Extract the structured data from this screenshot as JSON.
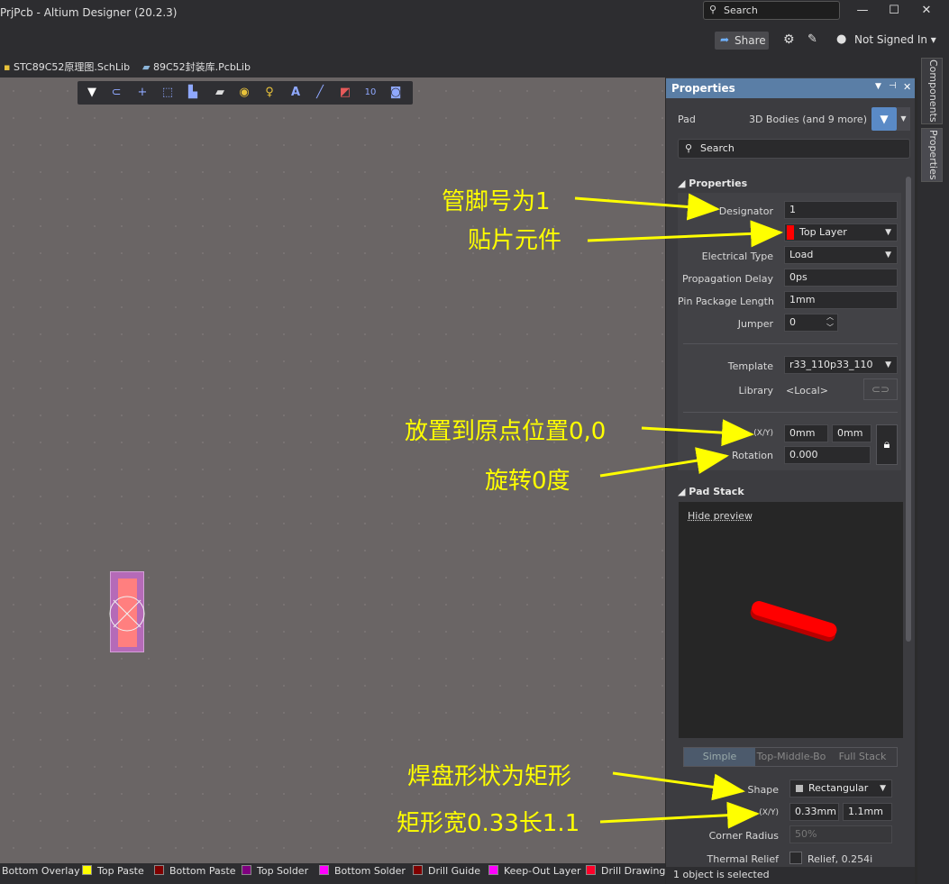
{
  "window": {
    "title": "PrjPcb - Altium Designer (20.2.3)",
    "search_placeholder": "Search",
    "minimize": "—",
    "maximize": "☐",
    "close": "✕"
  },
  "topbar": {
    "share": "Share",
    "user": "Not Signed In ▾"
  },
  "doc_tabs": [
    "STC89C52原理图.SchLib",
    "89C52封装库.PcbLib"
  ],
  "layers": [
    {
      "name": "Bottom Overlay",
      "color": "#2d2d30"
    },
    {
      "name": "Top Paste",
      "color": "#ffff00"
    },
    {
      "name": "Bottom Paste",
      "color": "#800000"
    },
    {
      "name": "Top Solder",
      "color": "#800080"
    },
    {
      "name": "Bottom Solder",
      "color": "#ff00ff"
    },
    {
      "name": "Drill Guide",
      "color": "#800000"
    },
    {
      "name": "Keep-Out Layer",
      "color": "#ff00ff"
    },
    {
      "name": "Drill Drawing",
      "color": "#ff002a"
    }
  ],
  "side_tabs": [
    "Components",
    "Properties"
  ],
  "panel": {
    "title": "Properties",
    "object": "Pad",
    "filter": "3D Bodies (and 9 more)",
    "search_placeholder": "Search",
    "sec_properties": "Properties",
    "designator_label": "Designator",
    "designator": "1",
    "layer": "Top Layer",
    "electrical_type_label": "Electrical Type",
    "electrical_type": "Load",
    "prop_delay_label": "Propagation Delay",
    "prop_delay": "0ps",
    "pin_pkg_label": "Pin Package Length",
    "pin_pkg": "1mm",
    "jumper_label": "Jumper",
    "jumper": "0",
    "template_label": "Template",
    "template": "r33_110p33_110",
    "library_label": "Library",
    "library": "<Local>",
    "xy_label": "(X/Y)",
    "x": "0mm",
    "y": "0mm",
    "rotation_label": "Rotation",
    "rotation": "0.000",
    "sec_padstack": "Pad Stack",
    "hide_preview": "Hide preview",
    "stack_tabs": [
      "Simple",
      "Top-Middle-Bo",
      "Full Stack"
    ],
    "shape_label": "Shape",
    "shape": "Rectangular",
    "size_label": "(X/Y)",
    "size_x": "0.33mm",
    "size_y": "1.1mm",
    "corner_label": "Corner Radius",
    "corner": "50%",
    "thermal_label": "Thermal Relief",
    "thermal": "Relief, 0.254i"
  },
  "status": "1 object is selected",
  "annotations": [
    "管脚号为1",
    "贴片元件",
    "放置到原点位置0,0",
    "旋转0度",
    "焊盘形状为矩形",
    "矩形宽0.33长1.1"
  ]
}
